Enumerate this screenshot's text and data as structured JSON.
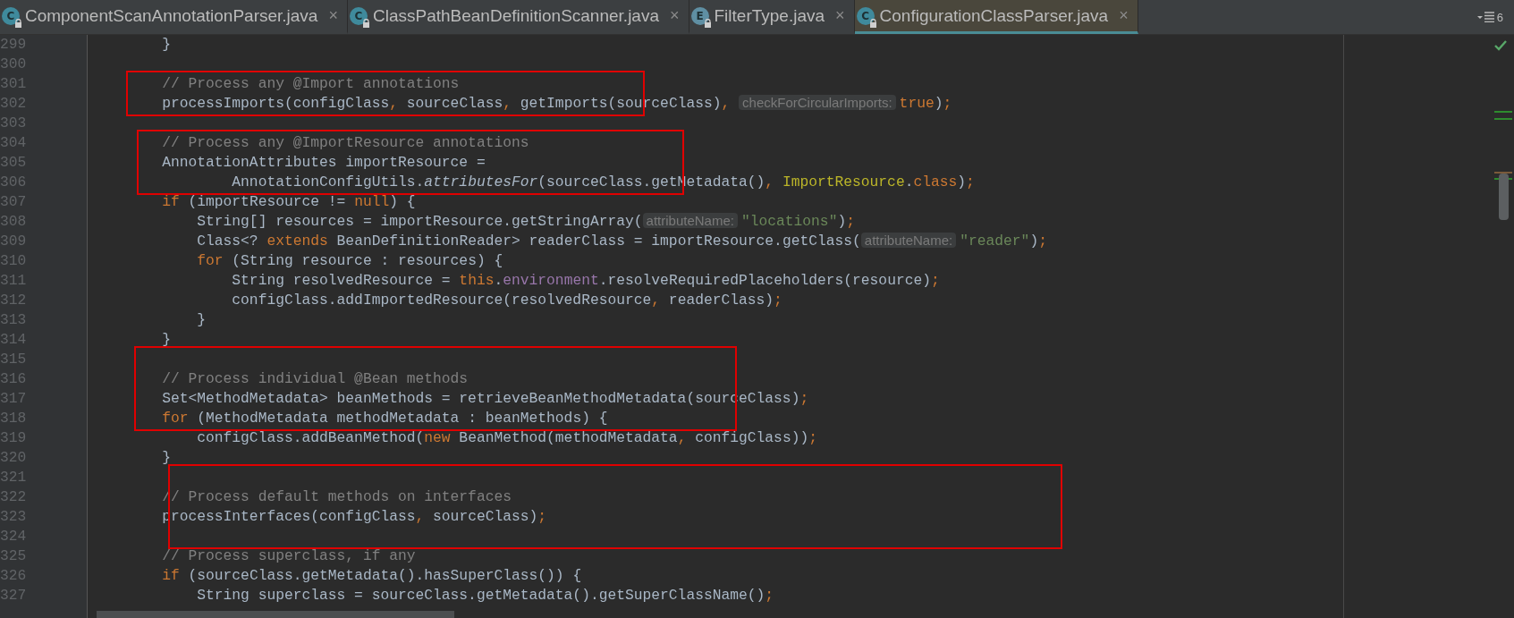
{
  "tabs": [
    {
      "icon": "C",
      "label": "ComponentScanAnnotationParser.java",
      "close": "×",
      "selected": false
    },
    {
      "icon": "C",
      "label": "ClassPathBeanDefinitionScanner.java",
      "close": "×",
      "selected": false
    },
    {
      "icon": "E",
      "label": "FilterType.java",
      "close": "×",
      "selected": false
    },
    {
      "icon": "C",
      "label": "ConfigurationClassParser.java",
      "close": "×",
      "selected": true
    }
  ],
  "tab_overflow": {
    "count": "6"
  },
  "lines": [
    {
      "number": "299",
      "in_red_box": false,
      "tokens": [
        {
          "kind": "plain",
          "text": "        }"
        }
      ]
    },
    {
      "number": "300",
      "in_red_box": false
    },
    {
      "number": "301",
      "in_red_box": true,
      "tokens": [
        {
          "kind": "comment",
          "text": "        // Process any @Import annotations"
        }
      ]
    },
    {
      "number": "302",
      "in_red_box": true,
      "tokens": [
        {
          "kind": "plain",
          "text": "        processImports(configClass"
        },
        {
          "kind": "keyword",
          "text": ","
        },
        {
          "kind": "plain",
          "text": " sourceClass"
        },
        {
          "kind": "keyword",
          "text": ","
        },
        {
          "kind": "plain",
          "text": " getImports(sourceClass)"
        },
        {
          "kind": "keyword",
          "text": ", "
        },
        {
          "kind": "hint",
          "text": "checkForCircularImports:"
        },
        {
          "kind": "keyword",
          "text": "true"
        },
        {
          "kind": "plain",
          "text": ")"
        },
        {
          "kind": "keyword",
          "text": ";"
        }
      ]
    },
    {
      "number": "303",
      "in_red_box": false
    },
    {
      "number": "304",
      "in_red_box": true,
      "tokens": [
        {
          "kind": "comment",
          "text": "        // Process any @ImportResource annotations"
        }
      ]
    },
    {
      "number": "305",
      "in_red_box": true,
      "tokens": [
        {
          "kind": "plain",
          "text": "        AnnotationAttributes importResource ="
        }
      ]
    },
    {
      "number": "306",
      "in_red_box": true,
      "tokens": [
        {
          "kind": "plain",
          "text": "                AnnotationConfigUtils."
        },
        {
          "kind": "italic",
          "text": "attributesFor"
        },
        {
          "kind": "plain",
          "text": "(sourceClass.getMetadata()"
        },
        {
          "kind": "keyword",
          "text": ", "
        },
        {
          "kind": "annotation",
          "text": "ImportResource"
        },
        {
          "kind": "plain",
          "text": "."
        },
        {
          "kind": "keyword",
          "text": "class"
        },
        {
          "kind": "plain",
          "text": ")"
        },
        {
          "kind": "keyword",
          "text": ";"
        }
      ]
    },
    {
      "number": "307",
      "in_red_box": false,
      "tokens": [
        {
          "kind": "keyword",
          "text": "        if"
        },
        {
          "kind": "plain",
          "text": " (importResource != "
        },
        {
          "kind": "keyword",
          "text": "null"
        },
        {
          "kind": "plain",
          "text": ") {"
        }
      ]
    },
    {
      "number": "308",
      "in_red_box": false,
      "tokens": [
        {
          "kind": "plain",
          "text": "            String[] resources = importResource.getStringArray("
        },
        {
          "kind": "hint",
          "text": "attributeName:"
        },
        {
          "kind": "string",
          "text": "\"locations\""
        },
        {
          "kind": "plain",
          "text": ")"
        },
        {
          "kind": "keyword",
          "text": ";"
        }
      ]
    },
    {
      "number": "309",
      "in_red_box": false,
      "tokens": [
        {
          "kind": "plain",
          "text": "            Class<? "
        },
        {
          "kind": "keyword",
          "text": "extends"
        },
        {
          "kind": "plain",
          "text": " BeanDefinitionReader> readerClass = importResource.getClass("
        },
        {
          "kind": "hint",
          "text": "attributeName:"
        },
        {
          "kind": "string",
          "text": "\"reader\""
        },
        {
          "kind": "plain",
          "text": ")"
        },
        {
          "kind": "keyword",
          "text": ";"
        }
      ]
    },
    {
      "number": "310",
      "in_red_box": false,
      "tokens": [
        {
          "kind": "keyword",
          "text": "            for"
        },
        {
          "kind": "plain",
          "text": " (String resource : resources) {"
        }
      ]
    },
    {
      "number": "311",
      "in_red_box": false,
      "tokens": [
        {
          "kind": "plain",
          "text": "                String resolvedResource = "
        },
        {
          "kind": "keyword",
          "text": "this"
        },
        {
          "kind": "plain",
          "text": "."
        },
        {
          "kind": "field",
          "text": "environment"
        },
        {
          "kind": "plain",
          "text": ".resolveRequiredPlaceholders(resource)"
        },
        {
          "kind": "keyword",
          "text": ";"
        }
      ]
    },
    {
      "number": "312",
      "in_red_box": false,
      "tokens": [
        {
          "kind": "plain",
          "text": "                configClass.addImportedResource(resolvedResource"
        },
        {
          "kind": "keyword",
          "text": ","
        },
        {
          "kind": "plain",
          "text": " readerClass)"
        },
        {
          "kind": "keyword",
          "text": ";"
        }
      ]
    },
    {
      "number": "313",
      "in_red_box": false,
      "tokens": [
        {
          "kind": "plain",
          "text": "            }"
        }
      ]
    },
    {
      "number": "314",
      "in_red_box": false,
      "tokens": [
        {
          "kind": "plain",
          "text": "        }"
        }
      ]
    },
    {
      "number": "315",
      "in_red_box": true
    },
    {
      "number": "316",
      "in_red_box": true,
      "tokens": [
        {
          "kind": "comment",
          "text": "        // Process individual @Bean methods"
        }
      ]
    },
    {
      "number": "317",
      "in_red_box": true,
      "tokens": [
        {
          "kind": "plain",
          "text": "        Set<MethodMetadata> beanMethods = retrieveBeanMethodMetadata(sourceClass)"
        },
        {
          "kind": "keyword",
          "text": ";"
        }
      ]
    },
    {
      "number": "318",
      "in_red_box": true,
      "tokens": [
        {
          "kind": "keyword",
          "text": "        for"
        },
        {
          "kind": "plain",
          "text": " (MethodMetadata methodMetadata : beanMethods) {"
        }
      ]
    },
    {
      "number": "319",
      "in_red_box": false,
      "tokens": [
        {
          "kind": "plain",
          "text": "            configClass.addBeanMethod("
        },
        {
          "kind": "keyword",
          "text": "new"
        },
        {
          "kind": "plain",
          "text": " BeanMethod(methodMetadata"
        },
        {
          "kind": "keyword",
          "text": ","
        },
        {
          "kind": "plain",
          "text": " configClass))"
        },
        {
          "kind": "keyword",
          "text": ";"
        }
      ]
    },
    {
      "number": "320",
      "in_red_box": false,
      "tokens": [
        {
          "kind": "plain",
          "text": "        }"
        }
      ]
    },
    {
      "number": "321",
      "in_red_box": true
    },
    {
      "number": "322",
      "in_red_box": true,
      "tokens": [
        {
          "kind": "comment",
          "text": "        // Process default methods on interfaces"
        }
      ]
    },
    {
      "number": "323",
      "in_red_box": true,
      "tokens": [
        {
          "kind": "plain",
          "text": "        processInterfaces(configClass"
        },
        {
          "kind": "keyword",
          "text": ","
        },
        {
          "kind": "plain",
          "text": " sourceClass)"
        },
        {
          "kind": "keyword",
          "text": ";"
        }
      ]
    },
    {
      "number": "324",
      "in_red_box": true
    },
    {
      "number": "325",
      "in_red_box": false,
      "tokens": [
        {
          "kind": "comment",
          "text": "        // Process superclass, if any"
        }
      ]
    },
    {
      "number": "326",
      "in_red_box": false,
      "tokens": [
        {
          "kind": "keyword",
          "text": "        if"
        },
        {
          "kind": "plain",
          "text": " (sourceClass.getMetadata().hasSuperClass()) {"
        }
      ]
    },
    {
      "number": "327",
      "in_red_box": false,
      "tokens": [
        {
          "kind": "plain",
          "text": "            String superclass = sourceClass.getMetadata().getSuperClassName()"
        },
        {
          "kind": "keyword",
          "text": ";"
        }
      ]
    }
  ]
}
